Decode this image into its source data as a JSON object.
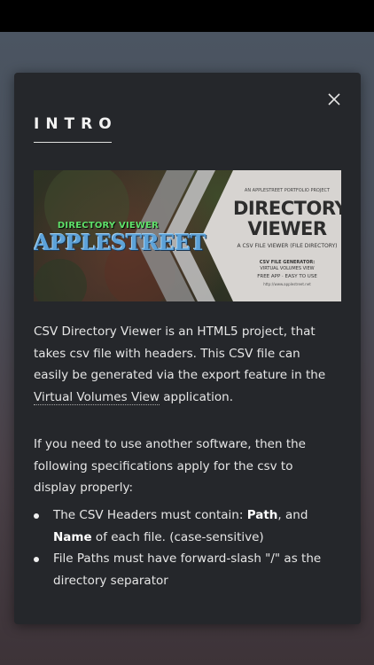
{
  "dialog": {
    "title": "INTRO",
    "close_icon": "close-icon"
  },
  "banner": {
    "left_subtitle": "DIRECTORY VIEWER",
    "left_title": "APPLESTREET",
    "tagline": "AN APPLESTREET PORTFOLIO PROJECT",
    "title_line1": "DIRECTORY",
    "title_line2": "VIEWER",
    "subtitle": "A CSV FILE VIEWER (FILE DIRECTORY)",
    "generator_label": "CSV FILE GENERATOR:",
    "generator_value": "VIRTUAL VOLUMES VIEW",
    "features": "FREE APP · EASY TO USE",
    "url": "http://www.applestreet.net"
  },
  "content": {
    "p1_before_link": "CSV Directory Viewer is an HTML5 project, that takes csv file with headers. This CSV file can easily be generated via the export feature in the ",
    "p1_link": "Virtual Volumes View",
    "p1_after_link": " application.",
    "p2": "If you need to use another software, then the following specifications apply for the csv to display properly:",
    "bullet1_before": "The CSV Headers must contain: ",
    "bullet1_path": "Path",
    "bullet1_and": ", and ",
    "bullet1_name": "Name",
    "bullet1_after": " of each file. (case-sensitive)",
    "bullet2": "File Paths must have forward-slash \"/\" as the directory separator"
  }
}
